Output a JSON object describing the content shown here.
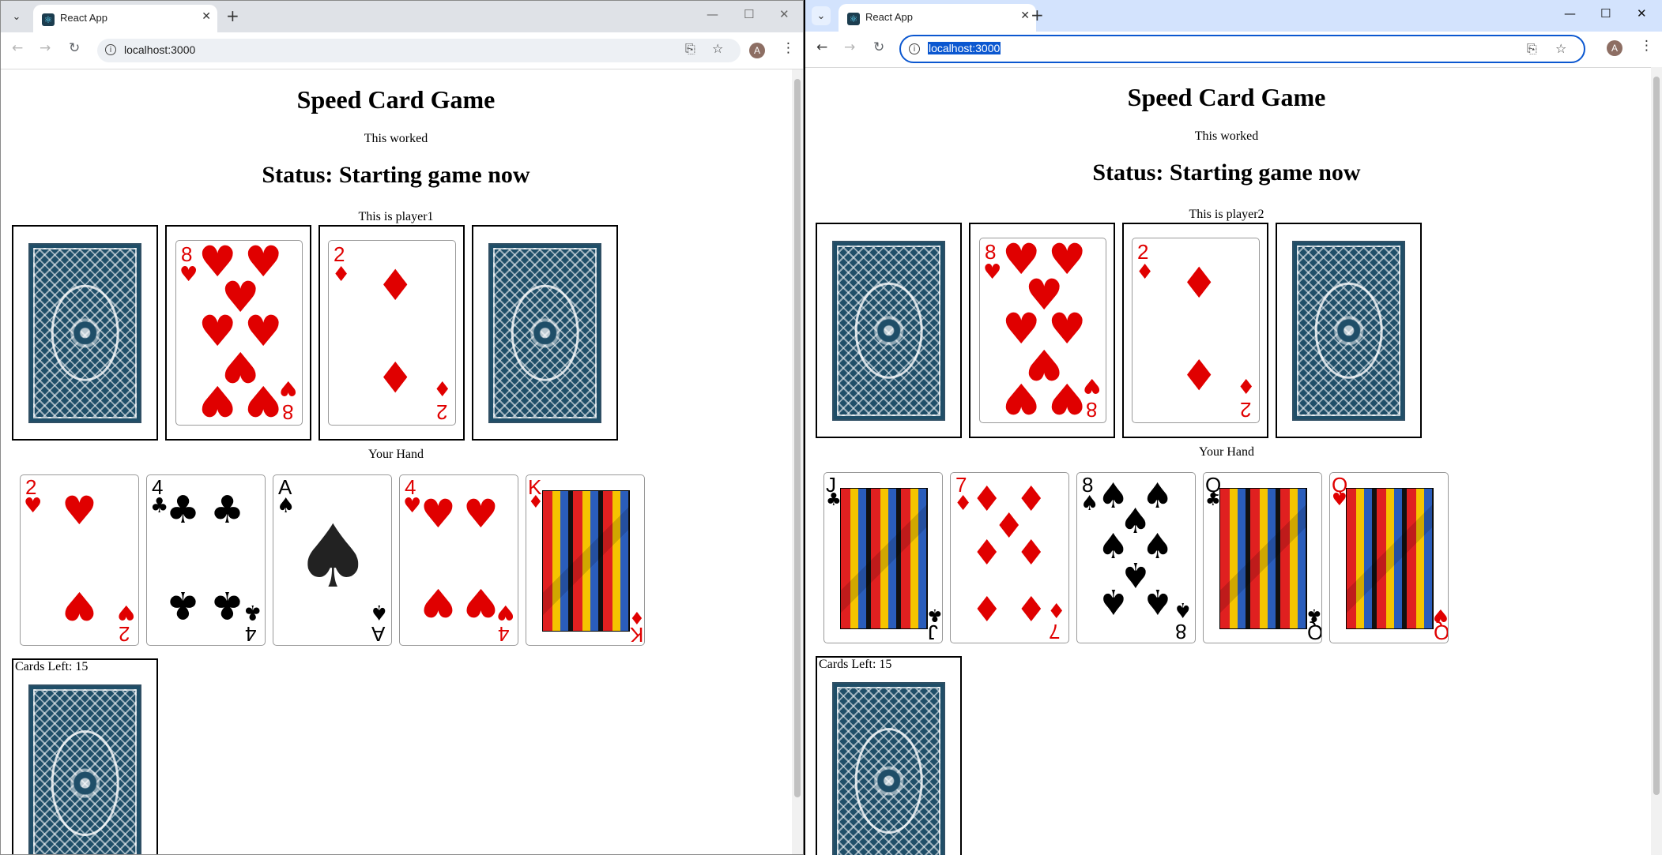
{
  "windows": [
    {
      "tab_title": "React App",
      "url": "localhost:3000",
      "avatar": "A",
      "page": {
        "title": "Speed Card Game",
        "message": "This worked",
        "status": "Status: Starting game now",
        "player_label": "This is player1",
        "center_piles": [
          {
            "face_down": true
          },
          {
            "rank": "8",
            "suit": "♥",
            "color": "red"
          },
          {
            "rank": "2",
            "suit": "♦",
            "color": "red"
          },
          {
            "face_down": true
          }
        ],
        "hand_label": "Your Hand",
        "hand": [
          {
            "rank": "2",
            "suit": "♥",
            "color": "red"
          },
          {
            "rank": "4",
            "suit": "♣",
            "color": "black"
          },
          {
            "rank": "A",
            "suit": "♠",
            "color": "black"
          },
          {
            "rank": "4",
            "suit": "♥",
            "color": "red"
          },
          {
            "rank": "K",
            "suit": "♦",
            "color": "red"
          }
        ],
        "cards_left": "Cards Left: 15"
      }
    },
    {
      "tab_title": "React App",
      "url": "localhost:3000",
      "avatar": "A",
      "page": {
        "title": "Speed Card Game",
        "message": "This worked",
        "status": "Status: Starting game now",
        "player_label": "This is player2",
        "center_piles": [
          {
            "face_down": true
          },
          {
            "rank": "8",
            "suit": "♥",
            "color": "red"
          },
          {
            "rank": "2",
            "suit": "♦",
            "color": "red"
          },
          {
            "face_down": true
          }
        ],
        "hand_label": "Your Hand",
        "hand": [
          {
            "rank": "J",
            "suit": "♣",
            "color": "black"
          },
          {
            "rank": "7",
            "suit": "♦",
            "color": "red"
          },
          {
            "rank": "8",
            "suit": "♠",
            "color": "black"
          },
          {
            "rank": "Q",
            "suit": "♣",
            "color": "black"
          },
          {
            "rank": "Q",
            "suit": "♥",
            "color": "red"
          }
        ],
        "cards_left": "Cards Left: 15"
      }
    }
  ],
  "icons": {
    "tab_search": "chevron-down-icon",
    "favicon": "react-icon",
    "close": "close-icon",
    "new_tab": "plus-icon",
    "back": "arrow-left-icon",
    "forward": "arrow-right-icon",
    "reload": "reload-icon",
    "site_info": "info-icon",
    "install": "install-app-icon",
    "bookmark": "star-icon",
    "menu": "kebab-menu-icon",
    "minimize": "minimize-icon",
    "maximize": "maximize-icon"
  },
  "colors": {
    "card_red": "#e00000",
    "card_back": "#1f4e68",
    "focus_blue": "#0b57d0",
    "tabstrip_inactive": "#dfe2e7",
    "tabstrip_active": "#d3e3fd"
  }
}
